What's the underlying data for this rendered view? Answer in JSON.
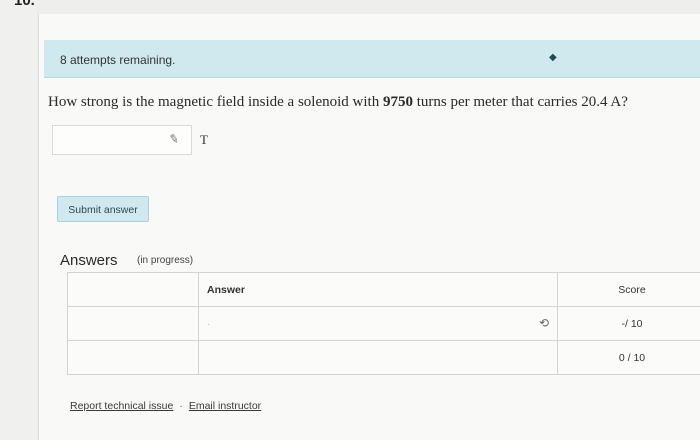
{
  "question_number": "10.",
  "attempts": {
    "text": "8 attempts remaining.",
    "icon": "dot-indicator-icon"
  },
  "question": {
    "prefix": "How strong is the magnetic field inside a solenoid with ",
    "turns": "9750",
    "middle": " turns per meter that carries ",
    "current": "20.4 A",
    "suffix": "?"
  },
  "answer_input": {
    "value": "",
    "unit": "T",
    "icon": "pencil-icon"
  },
  "submit_label": "Submit answer",
  "answers": {
    "title": "Answers",
    "subtitle": "(in progress)",
    "headers": {
      "answer": "Answer",
      "score": "Score"
    },
    "rows": [
      {
        "answer_dot": "·",
        "score": "-/ 10",
        "icon": "feedback-icon"
      },
      {
        "answer_dot": "",
        "score": "0 / 10"
      }
    ]
  },
  "footer": {
    "report_link": "Report technical issue",
    "separator": "·",
    "email_link": "Email instructor"
  }
}
